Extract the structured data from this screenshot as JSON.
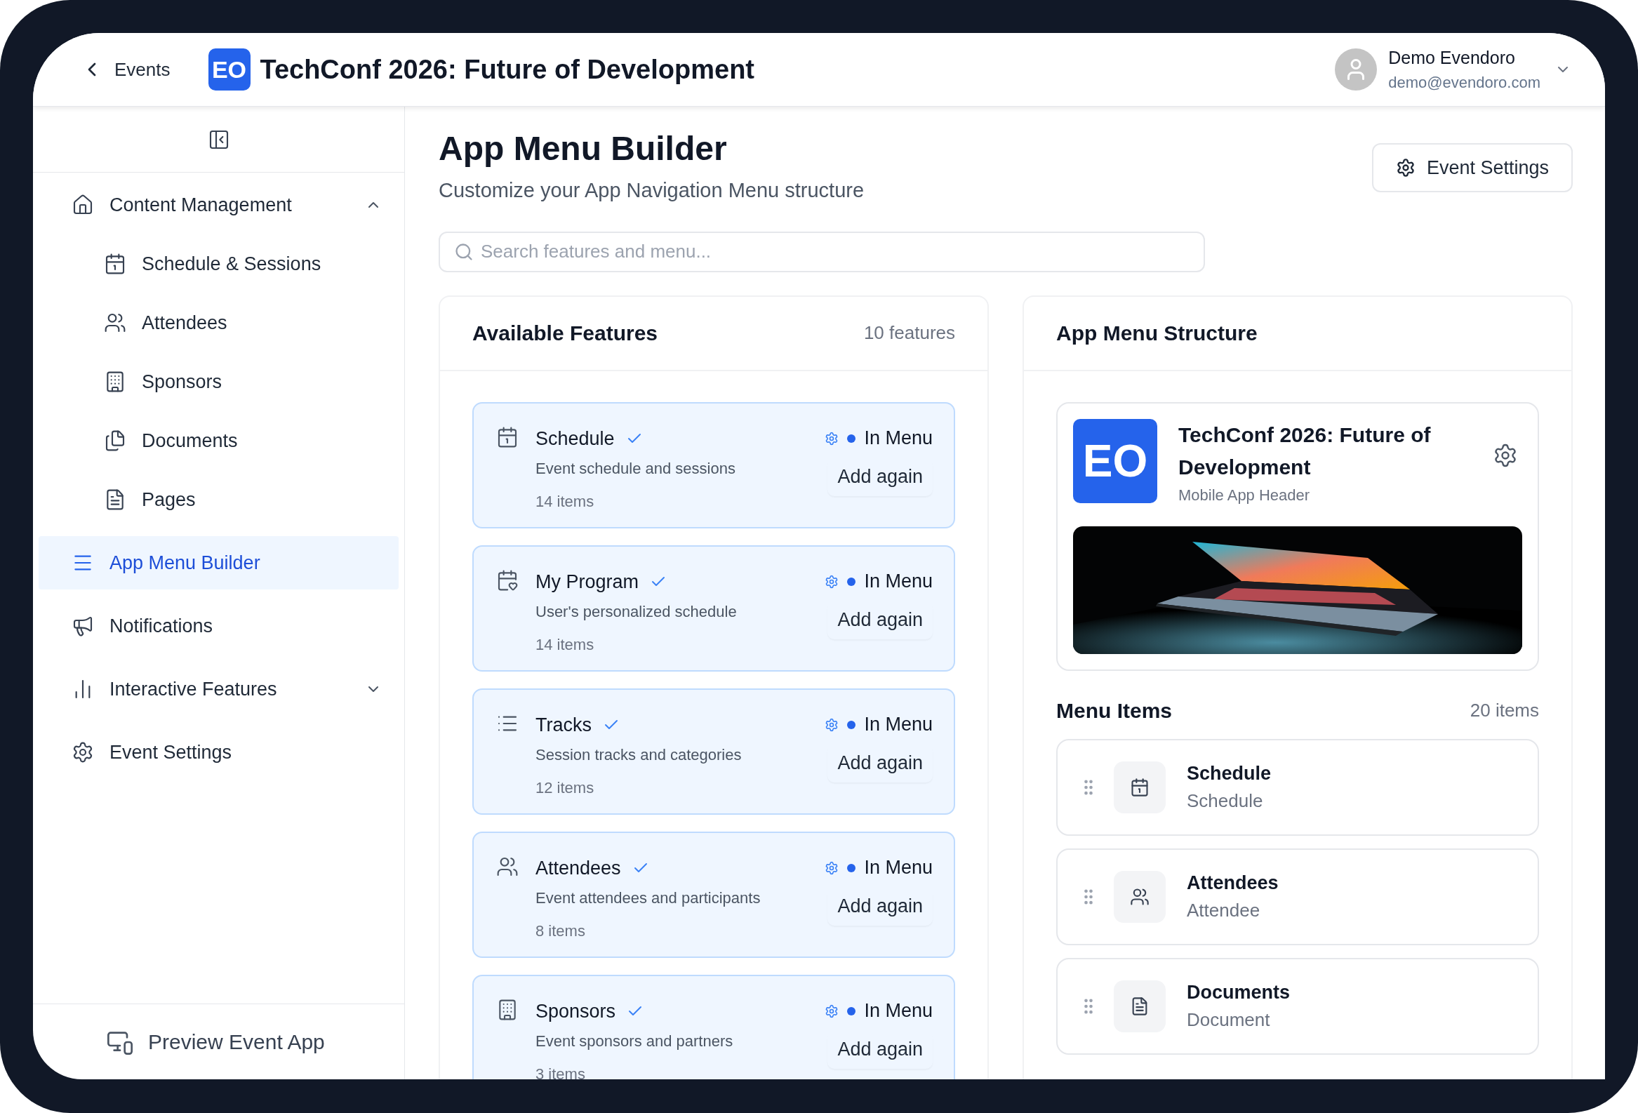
{
  "header": {
    "back_label": "Events",
    "logo": "EO",
    "event_title": "TechConf 2026: Future of Development",
    "user": {
      "name": "Demo Evendoro",
      "email": "demo@evendoro.com"
    }
  },
  "sidebar": {
    "items": [
      {
        "label": "Content Management",
        "selected": false,
        "expanded": true,
        "children": [
          {
            "label": "Schedule & Sessions",
            "selected": false
          },
          {
            "label": "Attendees",
            "selected": false
          },
          {
            "label": "Sponsors",
            "selected": false
          },
          {
            "label": "Documents",
            "selected": false
          },
          {
            "label": "Pages",
            "selected": false
          }
        ]
      },
      {
        "label": "App Menu Builder",
        "selected": true
      },
      {
        "label": "Notifications",
        "selected": false
      },
      {
        "label": "Interactive Features",
        "selected": false,
        "expanded": false
      },
      {
        "label": "Event Settings",
        "selected": false
      }
    ],
    "footer": "Preview Event App"
  },
  "page": {
    "title": "App Menu Builder",
    "subtitle": "Customize your App Navigation Menu structure",
    "settings_button": "Event Settings",
    "search": {
      "placeholder": "Search features and menu..."
    }
  },
  "features": {
    "title": "Available Features",
    "count": "10 features",
    "items": [
      {
        "name": "Schedule",
        "description": "Event schedule and sessions",
        "count": "14 items",
        "in_menu": true,
        "status": "In Menu",
        "action": "Add again"
      },
      {
        "name": "My Program",
        "description": "User's personalized schedule",
        "count": "14 items",
        "in_menu": true,
        "status": "In Menu",
        "action": "Add again"
      },
      {
        "name": "Tracks",
        "description": "Session tracks and categories",
        "count": "12 items",
        "in_menu": true,
        "status": "In Menu",
        "action": "Add again"
      },
      {
        "name": "Attendees",
        "description": "Event attendees and participants",
        "count": "8 items",
        "in_menu": true,
        "status": "In Menu",
        "action": "Add again"
      },
      {
        "name": "Sponsors",
        "description": "Event sponsors and partners",
        "count": "3 items",
        "in_menu": true,
        "status": "In Menu",
        "action": "Add again"
      }
    ]
  },
  "structure": {
    "title": "App Menu Structure",
    "header_card": {
      "logo": "EO",
      "title": "TechConf 2026: Future of Development",
      "subtitle": "Mobile App Header"
    },
    "menu_items": {
      "title": "Menu Items",
      "count": "20 items",
      "items": [
        {
          "title": "Schedule",
          "subtitle": "Schedule"
        },
        {
          "title": "Attendees",
          "subtitle": "Attendee"
        },
        {
          "title": "Documents",
          "subtitle": "Document"
        }
      ]
    }
  }
}
